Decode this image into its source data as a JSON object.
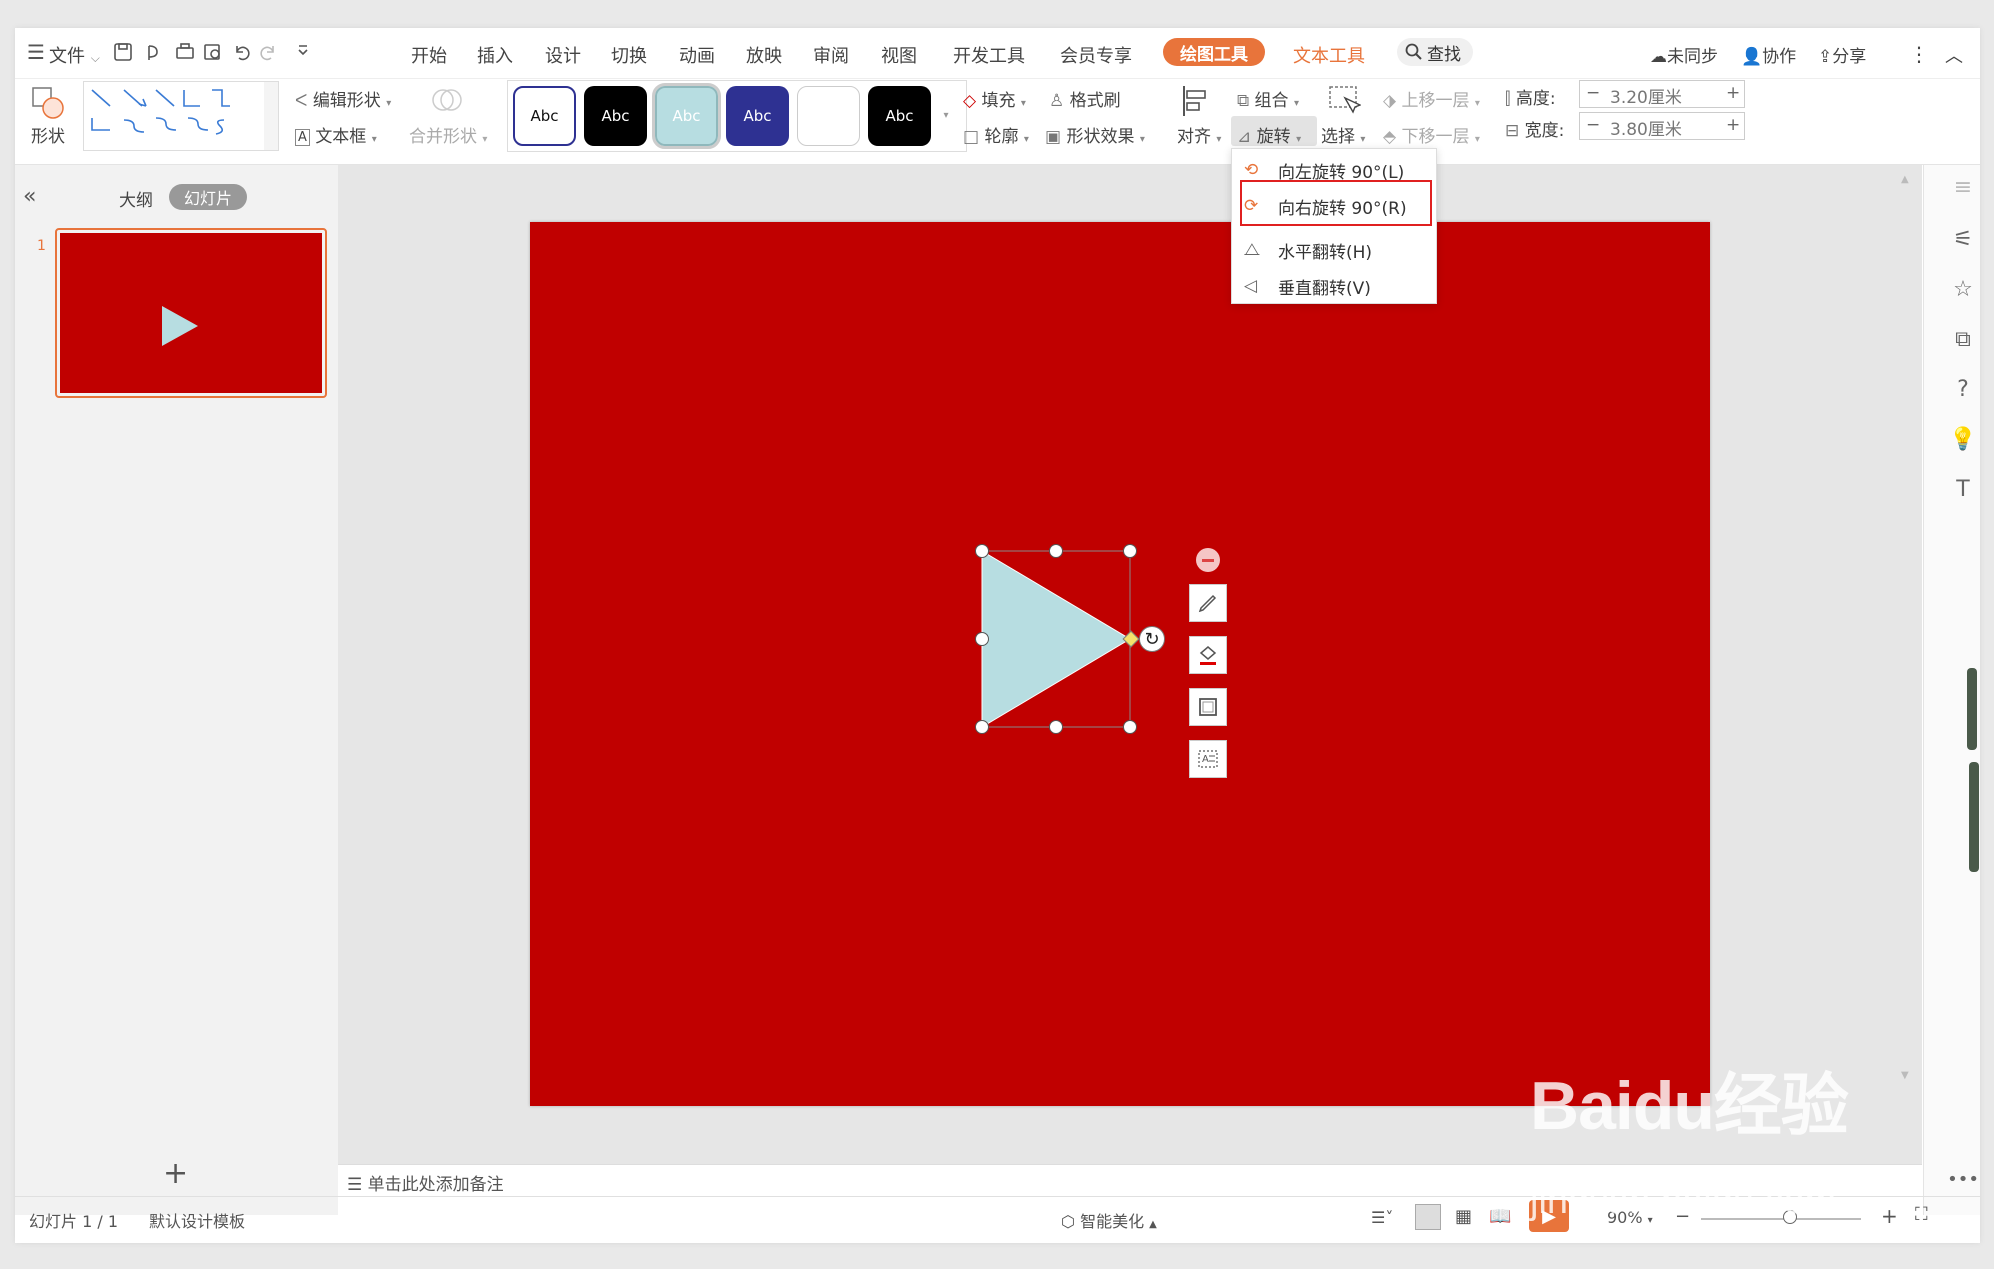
{
  "menubar": {
    "file": "文件",
    "tabs": [
      "开始",
      "插入",
      "设计",
      "切换",
      "动画",
      "放映",
      "审阅",
      "视图",
      "开发工具",
      "会员专享"
    ],
    "drawing_tools": "绘图工具",
    "text_tools": "文本工具",
    "search": "查找",
    "unsynced": "未同步",
    "collab": "协作",
    "share": "分享"
  },
  "ribbon": {
    "shape": "形状",
    "edit_shape": "编辑形状",
    "text_box": "文本框",
    "merge_shape": "合并形状",
    "style_label": "Abc",
    "fill": "填充",
    "format_brush": "格式刷",
    "outline": "轮廓",
    "shape_effect": "形状效果",
    "align": "对齐",
    "group": "组合",
    "rotate": "旋转",
    "select": "选择",
    "bring_forward": "上移一层",
    "send_backward": "下移一层",
    "height_label": "高度:",
    "height_value": "3.20厘米",
    "width_label": "宽度:",
    "width_value": "3.80厘米"
  },
  "rotate_menu": {
    "items": [
      "向左旋转 90°(L)",
      "向右旋转 90°(R)",
      "水平翻转(H)",
      "垂直翻转(V)"
    ],
    "highlighted_index": 1
  },
  "left_panel": {
    "outline_tab": "大纲",
    "slides_tab": "幻灯片",
    "slide_number": "1",
    "add": "+"
  },
  "notes_placeholder": "单击此处添加备注",
  "status": {
    "slide_info": "幻灯片 1 / 1",
    "template": "默认设计模板",
    "smart_beautify": "智能美化",
    "zoom": "90%"
  },
  "watermark": {
    "brand": "Baidu经验",
    "url": "jingyan.baidu.com"
  },
  "colors": {
    "slide_bg": "#c00000",
    "shape_fill": "#b7dde1",
    "accent_orange": "#e8743b",
    "highlight_red": "#e02020"
  }
}
